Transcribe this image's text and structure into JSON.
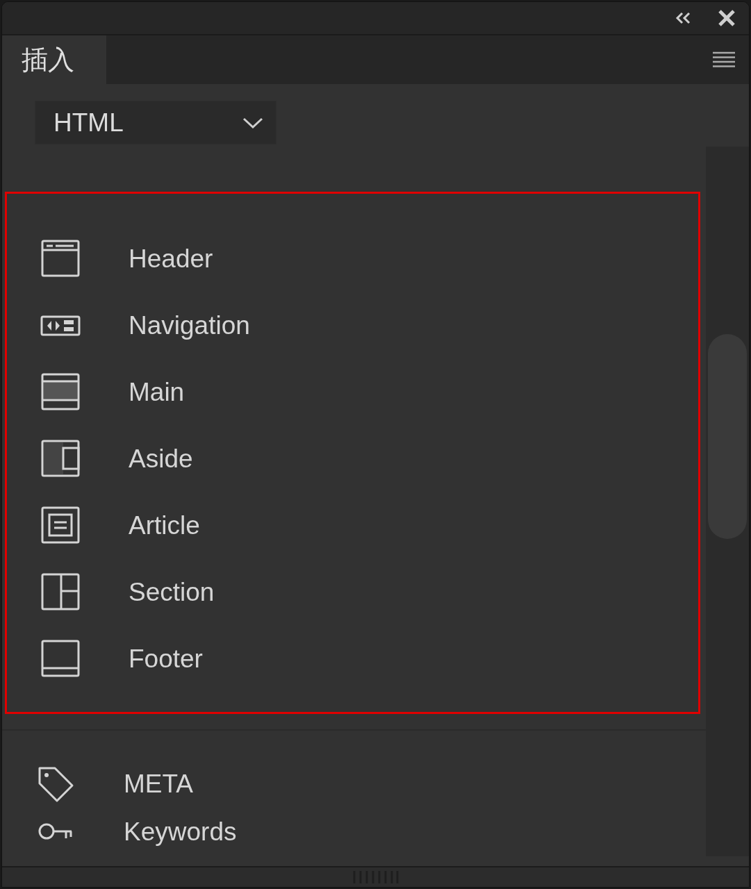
{
  "panel": {
    "tabs": [
      {
        "label": "插入",
        "selected": true
      }
    ],
    "category_dropdown": {
      "value": "HTML"
    },
    "highlighted_group": {
      "highlighted": true,
      "items": [
        {
          "label": "Header",
          "kind": "header"
        },
        {
          "label": "Navigation",
          "kind": "navigation"
        },
        {
          "label": "Main",
          "kind": "main"
        },
        {
          "label": "Aside",
          "kind": "aside"
        },
        {
          "label": "Article",
          "kind": "article"
        },
        {
          "label": "Section",
          "kind": "section"
        },
        {
          "label": "Footer",
          "kind": "footer"
        }
      ]
    },
    "more_items": [
      {
        "label": "META",
        "kind": "tag"
      },
      {
        "label": "Keywords",
        "kind": "key"
      }
    ]
  }
}
